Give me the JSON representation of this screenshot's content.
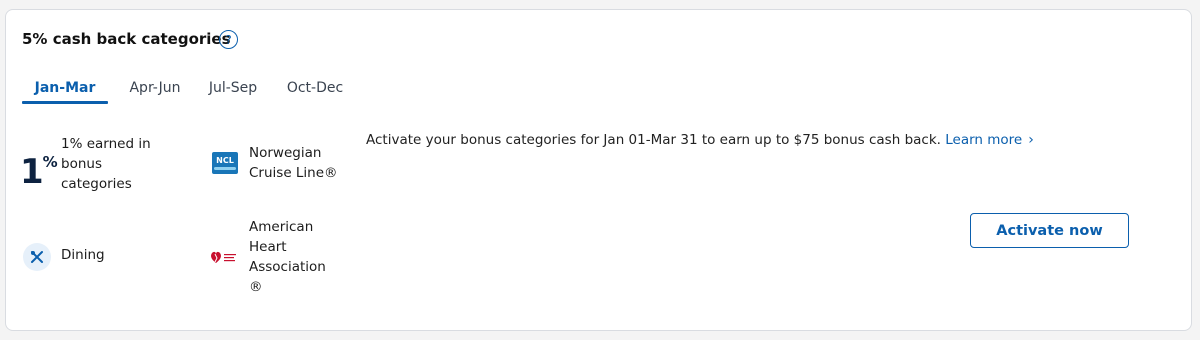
{
  "card": {
    "title": "5% cash back categories",
    "help_icon": "?"
  },
  "tabs": [
    {
      "label": "Jan-Mar",
      "active": true
    },
    {
      "label": "Apr-Jun",
      "active": false
    },
    {
      "label": "Jul-Sep",
      "active": false
    },
    {
      "label": "Oct-Dec",
      "active": false
    }
  ],
  "categories": {
    "earned": {
      "big": "1",
      "sup": "%",
      "label": "1% earned in bonus categories"
    },
    "ncl": {
      "logo_text": "NCL",
      "label": "Norwegian Cruise Line®"
    },
    "dining": {
      "icon": "fork-knife-icon",
      "label": "Dining"
    },
    "aha": {
      "icon": "american-heart-association-logo",
      "label": "American Heart Association ®"
    }
  },
  "promo": {
    "text": "Activate your bonus categories for Jan 01-Mar 31 to earn up to $75 bonus cash back.",
    "learn_more": "Learn more",
    "chevron": "›"
  },
  "activate_button": "Activate now",
  "colors": {
    "accent": "#0b5fad",
    "dark": "#0d2240",
    "ncl": "#1976b8",
    "aha_red": "#c8102e"
  }
}
